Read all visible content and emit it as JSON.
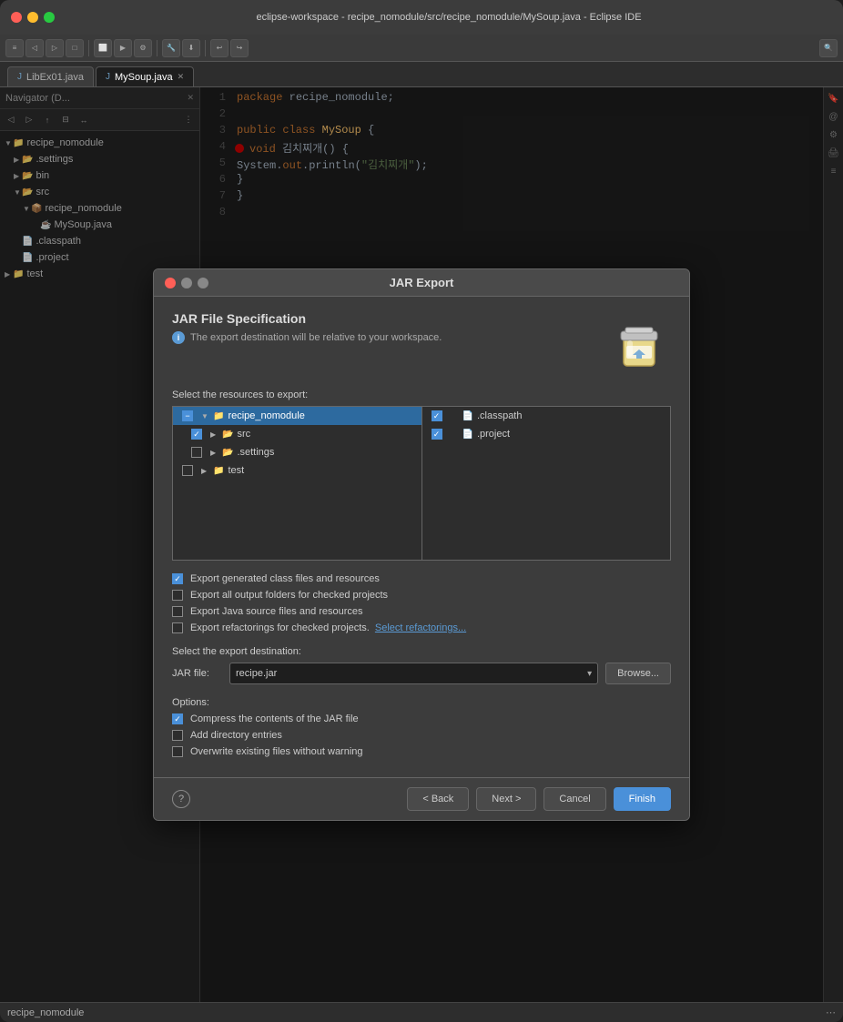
{
  "window": {
    "title": "eclipse-workspace - recipe_nomodule/src/recipe_nomodule/MySoup.java - Eclipse IDE",
    "traffic_lights": [
      "close",
      "minimize",
      "maximize"
    ]
  },
  "tabs": [
    {
      "id": "libex01",
      "label": "LibEx01.java",
      "active": false
    },
    {
      "id": "mysoup",
      "label": "MySoup.java",
      "active": true
    }
  ],
  "sidebar": {
    "title": "Navigator (D...",
    "items": [
      {
        "label": "recipe_nomodule",
        "indent": 0,
        "type": "project",
        "expanded": true
      },
      {
        "label": ".settings",
        "indent": 1,
        "type": "folder",
        "expanded": false
      },
      {
        "label": "bin",
        "indent": 1,
        "type": "folder",
        "expanded": false
      },
      {
        "label": "src",
        "indent": 1,
        "type": "folder",
        "expanded": true
      },
      {
        "label": "recipe_nomodule",
        "indent": 2,
        "type": "folder",
        "expanded": true
      },
      {
        "label": "MySoup.java",
        "indent": 3,
        "type": "java"
      },
      {
        "label": ".classpath",
        "indent": 1,
        "type": "file"
      },
      {
        "label": ".project",
        "indent": 1,
        "type": "file"
      },
      {
        "label": "test",
        "indent": 0,
        "type": "project",
        "expanded": false
      }
    ]
  },
  "code": {
    "lines": [
      {
        "num": "1",
        "content": "package recipe_nomodule;"
      },
      {
        "num": "2",
        "content": ""
      },
      {
        "num": "3",
        "content": "public class MySoup {"
      },
      {
        "num": "4",
        "content": "    void 김치찌개() {",
        "breakpoint": true
      },
      {
        "num": "5",
        "content": "        System.out.println(\"김치찌개\");"
      },
      {
        "num": "6",
        "content": "    }"
      },
      {
        "num": "7",
        "content": "}"
      },
      {
        "num": "8",
        "content": ""
      }
    ]
  },
  "dialog": {
    "title": "JAR Export",
    "close_btn": "●",
    "header": {
      "title": "JAR File Specification",
      "info_text": "The export destination will be relative to your workspace."
    },
    "resources_label": "Select the resources to export:",
    "left_tree": [
      {
        "label": "recipe_nomodule",
        "selected": true,
        "indent": 0,
        "expanded": true,
        "cb_state": "indeterminate",
        "type": "project"
      },
      {
        "label": "src",
        "selected": false,
        "indent": 1,
        "expanded": false,
        "cb_state": "checked",
        "type": "folder"
      },
      {
        "label": ".settings",
        "selected": false,
        "indent": 1,
        "expanded": false,
        "cb_state": "unchecked",
        "type": "folder"
      },
      {
        "label": "test",
        "selected": false,
        "indent": 0,
        "expanded": false,
        "cb_state": "unchecked",
        "type": "project"
      }
    ],
    "right_tree": [
      {
        "label": ".classpath",
        "indent": 0,
        "cb_state": "checked",
        "type": "file"
      },
      {
        "label": ".project",
        "indent": 0,
        "cb_state": "checked",
        "type": "file"
      }
    ],
    "checkboxes": [
      {
        "id": "export_class",
        "label": "Export generated class files and resources",
        "checked": true
      },
      {
        "id": "export_output",
        "label": "Export all output folders for checked projects",
        "checked": false
      },
      {
        "id": "export_source",
        "label": "Export Java source files and resources",
        "checked": false
      },
      {
        "id": "export_refactor",
        "label": "Export refactorings for checked projects.",
        "checked": false,
        "link": "Select refactorings..."
      }
    ],
    "destination_label": "Select the export destination:",
    "jar_label": "JAR file:",
    "jar_value": "recipe.jar",
    "browse_label": "Browse...",
    "options_label": "Options:",
    "options": [
      {
        "id": "compress",
        "label": "Compress the contents of the JAR file",
        "checked": true
      },
      {
        "id": "add_dir",
        "label": "Add directory entries",
        "checked": false
      },
      {
        "id": "overwrite",
        "label": "Overwrite existing files without warning",
        "checked": false
      }
    ],
    "footer": {
      "help": "?",
      "back": "< Back",
      "next": "Next >",
      "cancel": "Cancel",
      "finish": "Finish"
    }
  },
  "status_bar": {
    "text": "recipe_nomodule"
  }
}
